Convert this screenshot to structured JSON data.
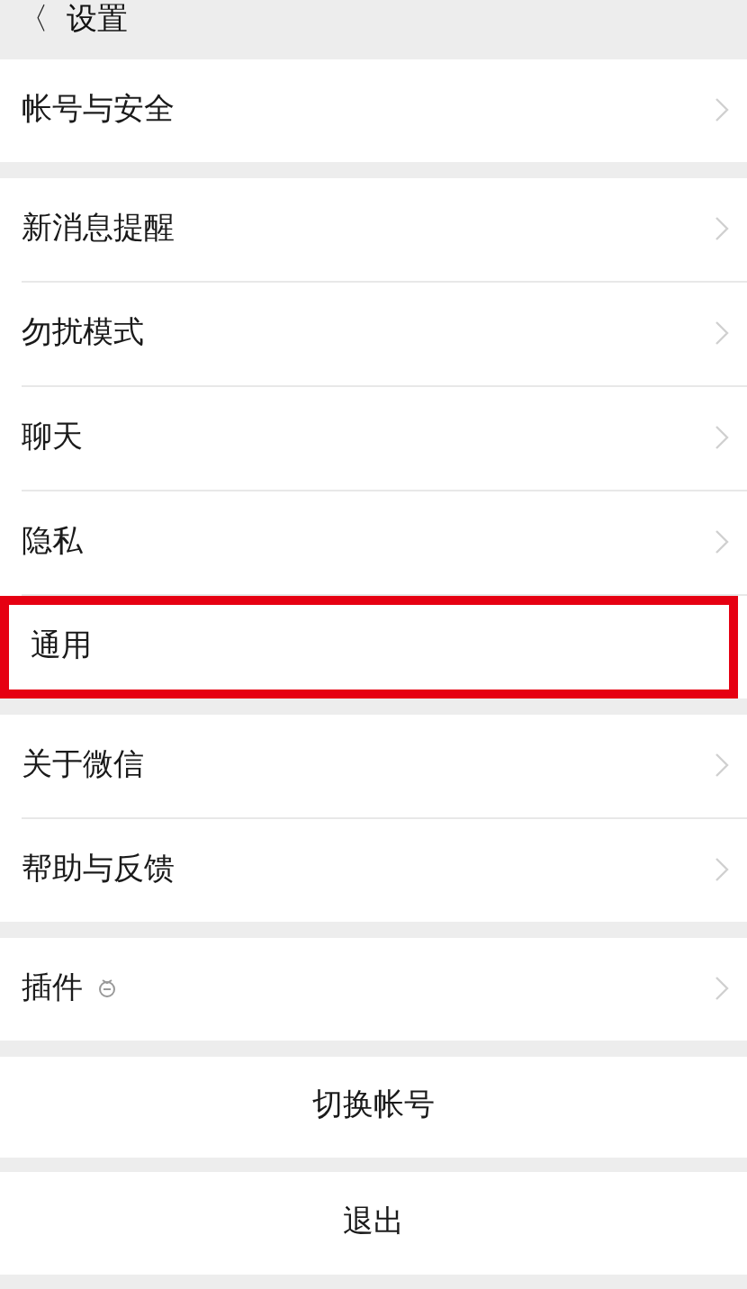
{
  "header": {
    "back": "〈",
    "title": "设置"
  },
  "sections": [
    {
      "items": [
        {
          "label": "帐号与安全",
          "highlighted": false,
          "badge": false
        }
      ]
    },
    {
      "items": [
        {
          "label": "新消息提醒",
          "highlighted": false,
          "badge": false
        },
        {
          "label": "勿扰模式",
          "highlighted": false,
          "badge": false
        },
        {
          "label": "聊天",
          "highlighted": false,
          "badge": false
        },
        {
          "label": "隐私",
          "highlighted": false,
          "badge": false
        },
        {
          "label": "通用",
          "highlighted": true,
          "badge": false
        }
      ]
    },
    {
      "items": [
        {
          "label": "关于微信",
          "highlighted": false,
          "badge": false
        },
        {
          "label": "帮助与反馈",
          "highlighted": false,
          "badge": false
        }
      ]
    },
    {
      "items": [
        {
          "label": "插件",
          "highlighted": false,
          "badge": true
        }
      ]
    }
  ],
  "buttons": [
    "切换帐号",
    "退出"
  ]
}
